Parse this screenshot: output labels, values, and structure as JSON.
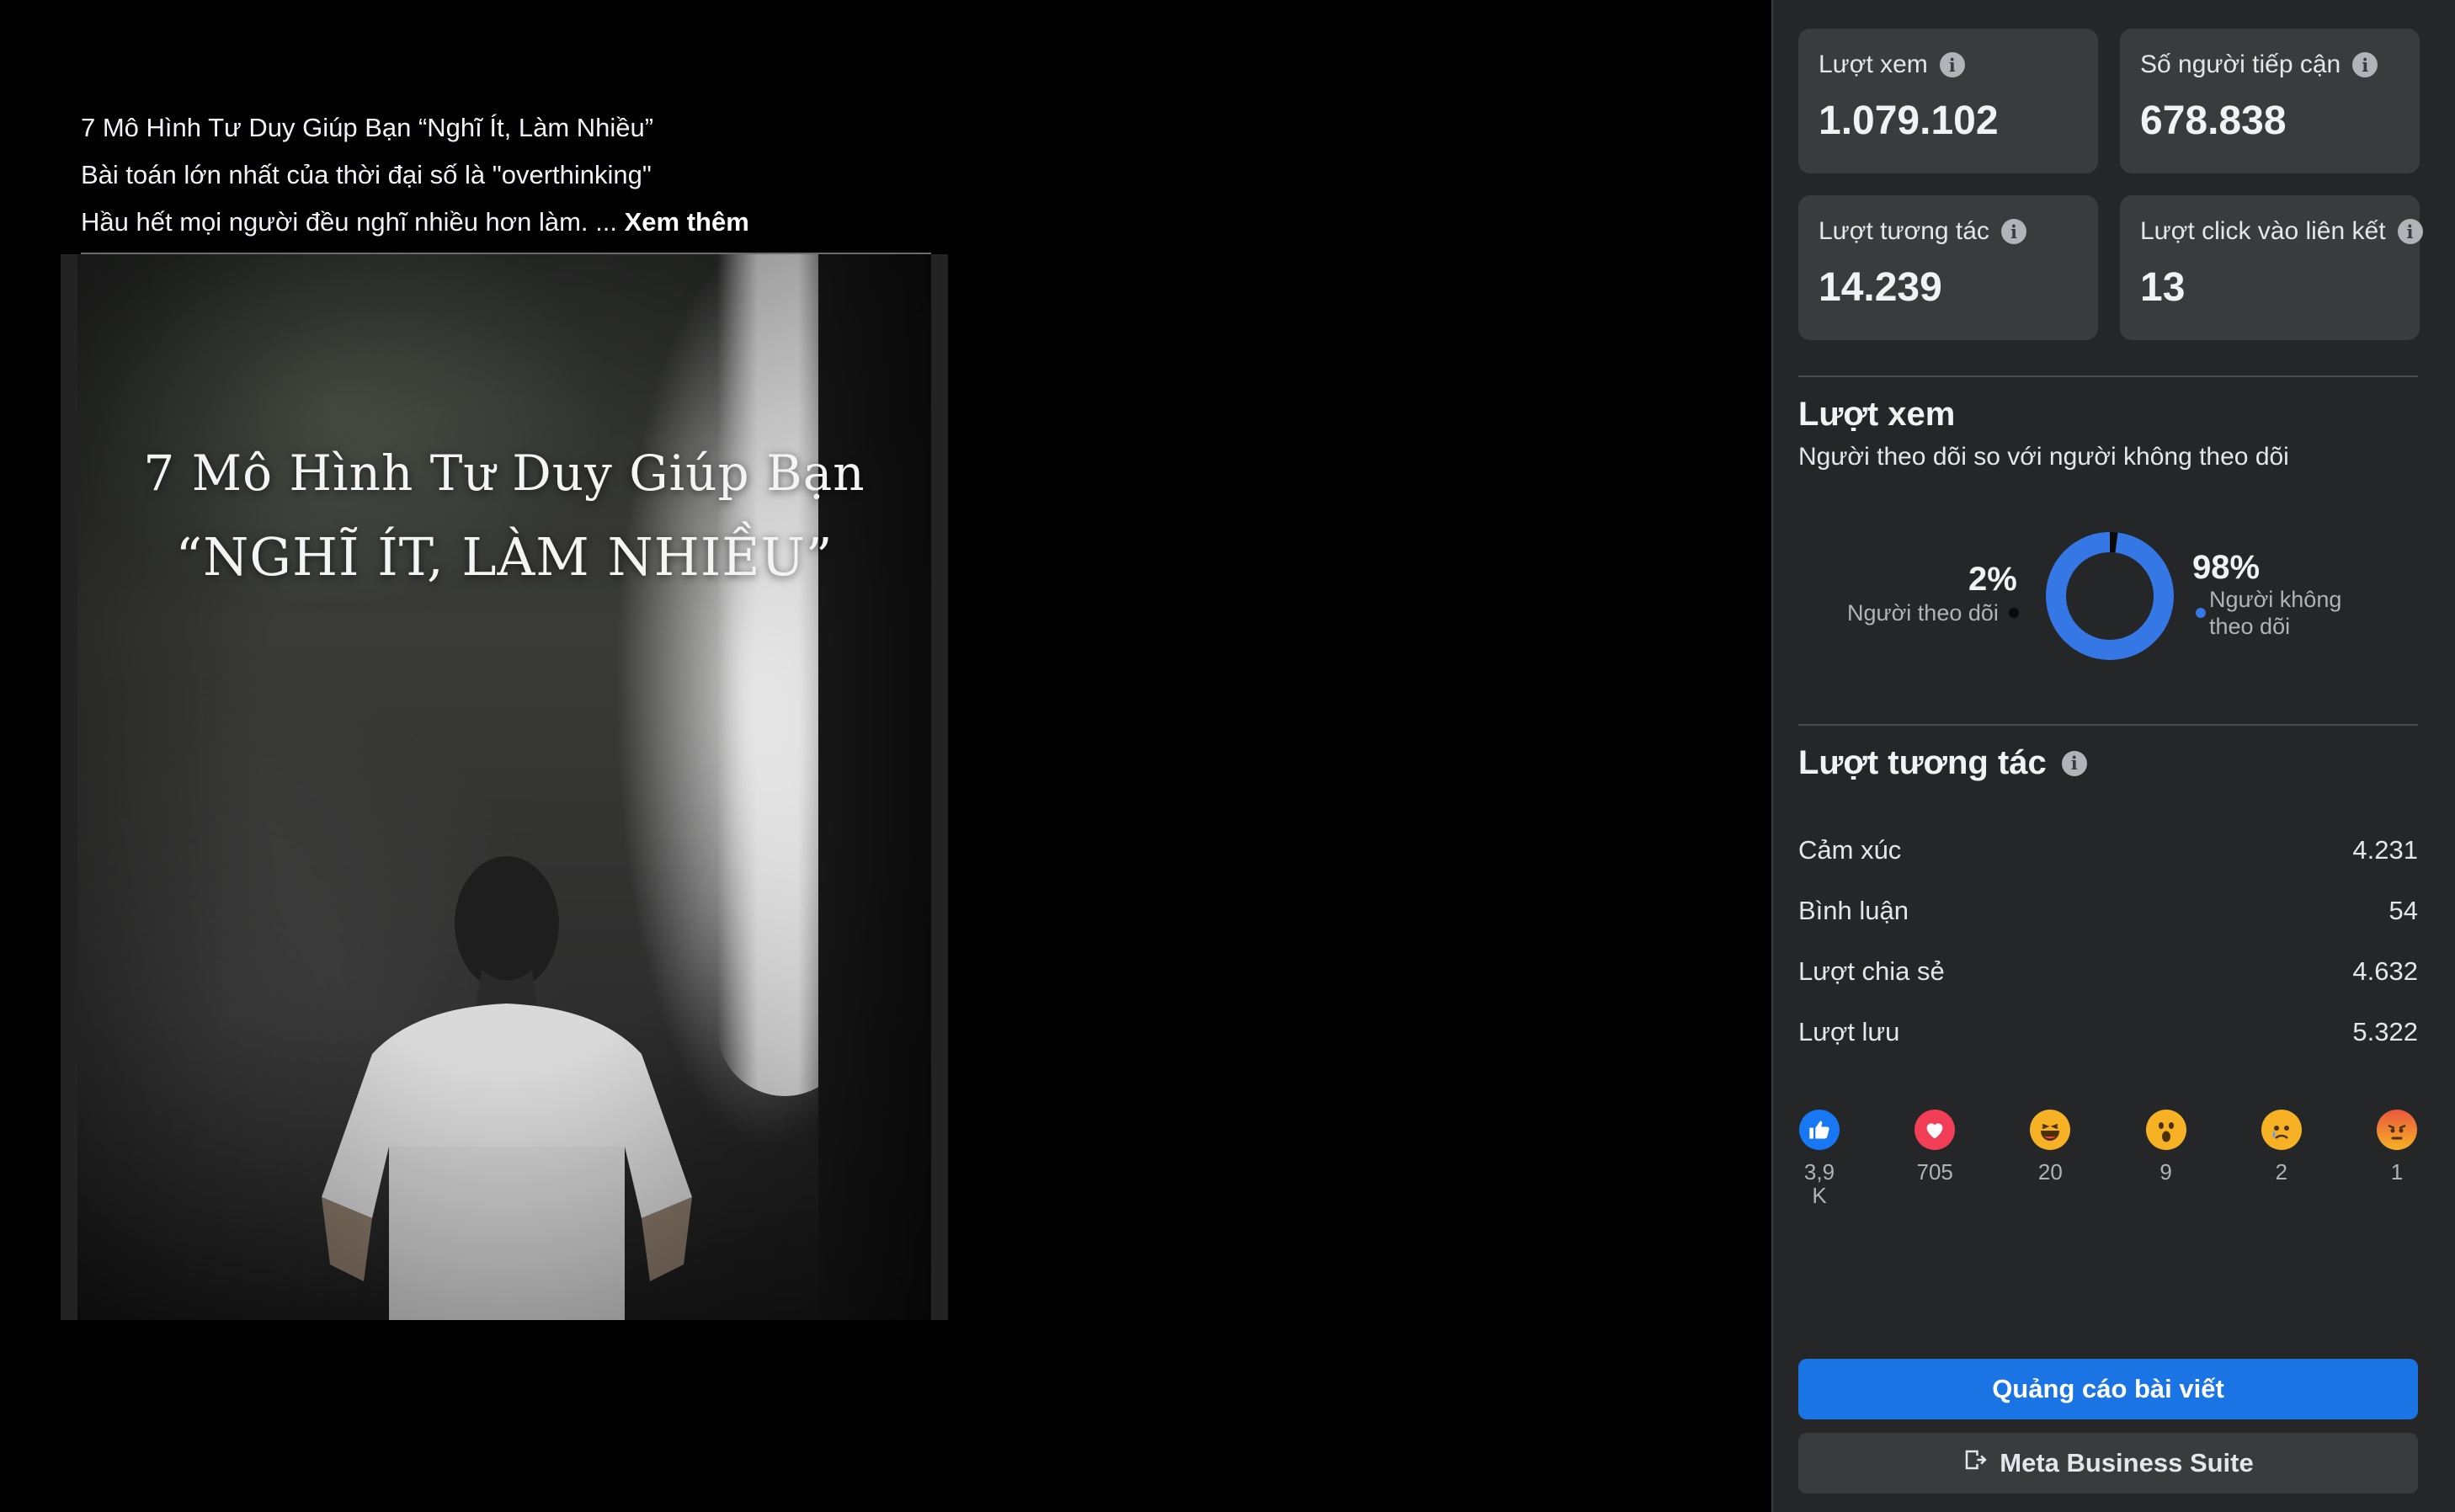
{
  "post": {
    "caption_line1": "7 Mô Hình Tư Duy Giúp Bạn “Nghĩ Ít, Làm Nhiều”",
    "caption_line2": "Bài toán lớn nhất của thời đại số là \"overthinking\"",
    "caption_line3": "Hầu hết mọi người đều nghĩ nhiều hơn làm. ...",
    "see_more": "Xem thêm",
    "media_title_line1": "7 Mô Hình Tư Duy Giúp Bạn",
    "media_title_line2": "“NGHĨ ÍT, LÀM NHIỀU”"
  },
  "stats": [
    {
      "label": "Lượt xem",
      "value": "1.079.102"
    },
    {
      "label": "Số người tiếp cận",
      "value": "678.838"
    },
    {
      "label": "Lượt tương tác",
      "value": "14.239"
    },
    {
      "label": "Lượt click vào liên kết",
      "value": "13"
    }
  ],
  "views_section": {
    "title": "Lượt xem",
    "subtitle": "Người theo dõi so với người không theo dõi",
    "followers_pct": "2%",
    "followers_label": "Người theo dõi",
    "non_followers_pct": "98%",
    "non_followers_label_line1": "Người không",
    "non_followers_label_line2": "theo dõi",
    "followers_fraction": 0.02,
    "colors": {
      "non_followers": "#3578e5",
      "followers": "#0a0a0a"
    }
  },
  "engagement": {
    "title": "Lượt tương tác",
    "rows": [
      {
        "label": "Cảm xúc",
        "value": "4.231"
      },
      {
        "label": "Bình luận",
        "value": "54"
      },
      {
        "label": "Lượt chia sẻ",
        "value": "4.632"
      },
      {
        "label": "Lượt lưu",
        "value": "5.322"
      }
    ],
    "reactions": [
      {
        "icon": "like-icon",
        "count": "3,9 K"
      },
      {
        "icon": "love-icon",
        "count": "705"
      },
      {
        "icon": "haha-icon",
        "count": "20"
      },
      {
        "icon": "wow-icon",
        "count": "9"
      },
      {
        "icon": "sad-icon",
        "count": "2"
      },
      {
        "icon": "angry-icon",
        "count": "1"
      }
    ]
  },
  "buttons": {
    "boost": "Quảng cáo bài viết",
    "business_suite": "Meta Business Suite"
  }
}
